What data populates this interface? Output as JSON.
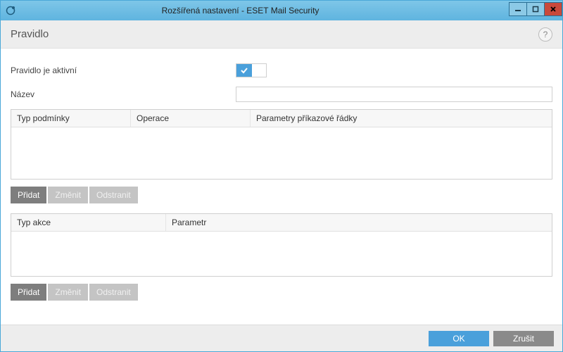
{
  "window": {
    "title": "Rozšířená nastavení - ESET Mail Security"
  },
  "section": {
    "title": "Pravidlo"
  },
  "form": {
    "active_label": "Pravidlo je aktivní",
    "name_label": "Název",
    "name_value": ""
  },
  "conditions_table": {
    "columns": [
      "Typ podmínky",
      "Operace",
      "Parametry příkazové řádky"
    ]
  },
  "conditions_buttons": {
    "add": "Přidat",
    "edit": "Změnit",
    "remove": "Odstranit"
  },
  "actions_table": {
    "columns": [
      "Typ akce",
      "Parametr"
    ]
  },
  "actions_buttons": {
    "add": "Přidat",
    "edit": "Změnit",
    "remove": "Odstranit"
  },
  "footer": {
    "ok": "OK",
    "cancel": "Zrušit"
  }
}
